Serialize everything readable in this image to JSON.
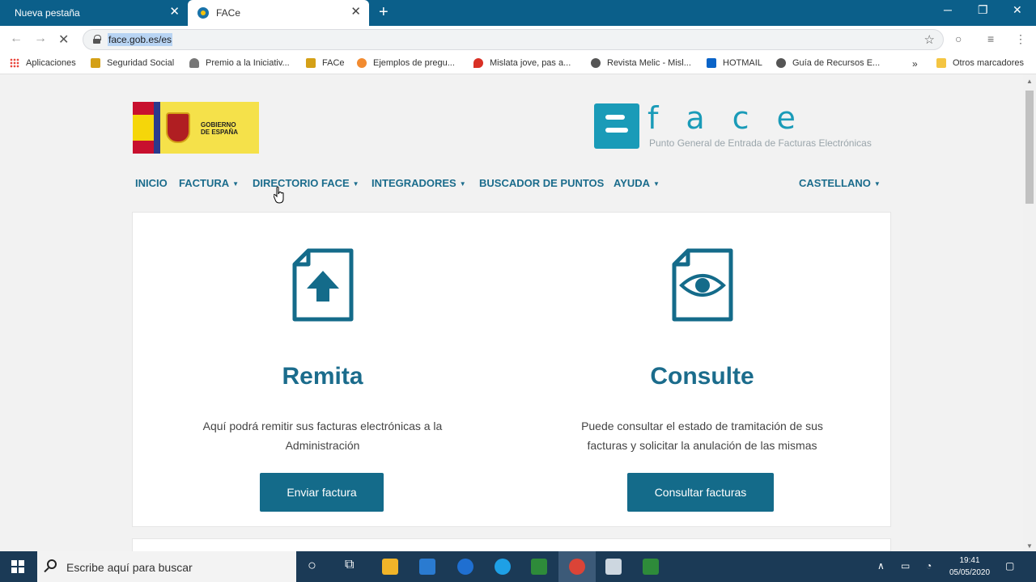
{
  "browser": {
    "tabs": [
      {
        "label": "Nueva pestaña",
        "active": false
      },
      {
        "label": "FACe",
        "active": true
      }
    ],
    "url": "face.gob.es/es",
    "bookmarks": [
      {
        "label": "Aplicaciones",
        "icon": "apps-grid-icon",
        "color": "#e8453c"
      },
      {
        "label": "Seguridad Social",
        "icon": "seguridad-social-icon",
        "color": "#d4a017"
      },
      {
        "label": "Premio a la Iniciativ...",
        "icon": "trophy-icon",
        "color": "#777777"
      },
      {
        "label": "FACe",
        "icon": "face-favicon-icon",
        "color": "#d4a017"
      },
      {
        "label": "Ejemplos de pregu...",
        "icon": "orange-circle-icon",
        "color": "#f28b30"
      },
      {
        "label": "Mislata jove, pas a...",
        "icon": "map-pin-icon",
        "color": "#d93025"
      },
      {
        "label": "Revista Melic - Misl...",
        "icon": "globe-icon",
        "color": "#555555"
      },
      {
        "label": "HOTMAIL",
        "icon": "outlook-icon",
        "color": "#0a64c8"
      },
      {
        "label": "Guía de Recursos E...",
        "icon": "globe-icon",
        "color": "#555555"
      },
      {
        "label": "Otros marcadores",
        "icon": "folder-icon",
        "color": "#f4c542"
      }
    ]
  },
  "site": {
    "gov_logo_text": "GOBIERNO\nDE ESPAÑA",
    "face_letters": "face",
    "face_subtitle": "Punto General de Entrada de Facturas Electrónicas",
    "nav": {
      "inicio": "INICIO",
      "factura": "FACTURA",
      "directorio": "DIRECTORIO FACE",
      "integradores": "INTEGRADORES",
      "buscador": "BUSCADOR DE PUNTOS",
      "ayuda": "AYUDA",
      "idioma": "CASTELLANO"
    },
    "remita": {
      "title": "Remita",
      "text": "Aquí podrá remitir sus facturas electrónicas a la Administración",
      "button": "Enviar factura"
    },
    "consulte": {
      "title": "Consulte",
      "text": "Puede consultar el estado de tramitación de sus facturas y solicitar la anulación de las mismas",
      "button": "Consultar facturas"
    },
    "accent_color": "#1b6c8c"
  },
  "taskbar": {
    "search_placeholder": "Escribe aquí para buscar",
    "time": "19:41",
    "date": "05/05/2020"
  }
}
